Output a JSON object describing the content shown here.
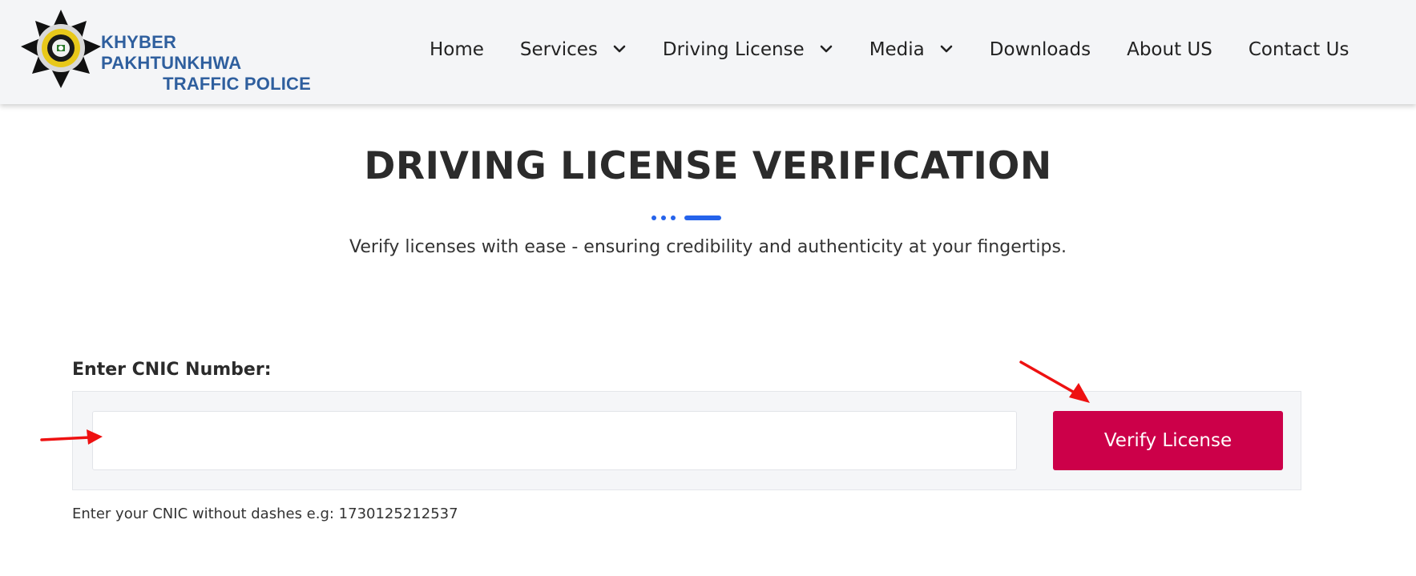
{
  "header": {
    "logo_icon": "kp-traffic-police-badge",
    "logo_line1": "KHYBER PAKHTUNKHWA",
    "logo_line2": "TRAFFIC POLICE",
    "nav": [
      {
        "label": "Home",
        "dropdown": false
      },
      {
        "label": "Services",
        "dropdown": true
      },
      {
        "label": "Driving License",
        "dropdown": true
      },
      {
        "label": "Media",
        "dropdown": true
      },
      {
        "label": "Downloads",
        "dropdown": false
      },
      {
        "label": "About US",
        "dropdown": false
      },
      {
        "label": "Contact Us",
        "dropdown": false
      }
    ]
  },
  "hero": {
    "title": "DRIVING LICENSE VERIFICATION",
    "subtitle": "Verify licenses with ease - ensuring credibility and authenticity at your fingertips."
  },
  "form": {
    "label": "Enter CNIC Number:",
    "input_value": "",
    "input_placeholder": "",
    "button_label": "Verify License",
    "hint": "Enter your CNIC without dashes e.g: 1730125212537"
  },
  "colors": {
    "accent_blue": "#2563eb",
    "button_crimson": "#cc0049",
    "logo_blue": "#2f5f9e",
    "annotation_red": "#ee1111"
  }
}
